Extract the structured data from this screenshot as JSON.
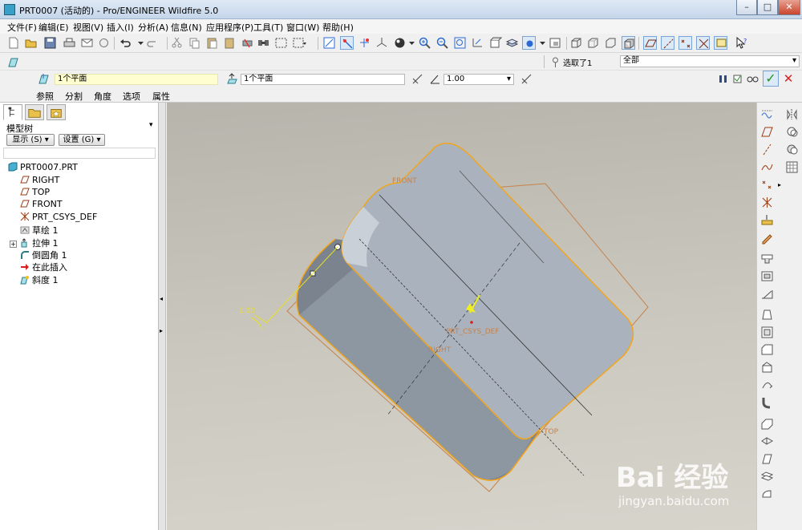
{
  "window": {
    "title": "PRT0007 (活动的) - Pro/ENGINEER Wildfire 5.0",
    "minimize": "–",
    "maximize": "□",
    "close": "✕"
  },
  "menu": [
    "文件(F)",
    "编辑(E)",
    "视图(V)",
    "插入(I)",
    "分析(A)",
    "信息(N)",
    "应用程序(P)",
    "工具(T)",
    "窗口(W)",
    "帮助(H)"
  ],
  "dashboard": {
    "selection_status": "选取了1",
    "filter_value": "全部",
    "ref1_value": "1个平面",
    "ref2_value": "1个平面",
    "angle_value": "1.00",
    "tabs": [
      "参照",
      "分割",
      "角度",
      "选项",
      "属性"
    ],
    "ok_label": "✓",
    "cancel_label": "✕"
  },
  "model_tree": {
    "title": "模型树",
    "show_button": "显示 (S) ▾",
    "settings_button": "设置 (G) ▾",
    "items": [
      {
        "label": "PRT0007.PRT",
        "icon": "part-icon"
      },
      {
        "label": "RIGHT",
        "icon": "datum-plane-icon"
      },
      {
        "label": "TOP",
        "icon": "datum-plane-icon"
      },
      {
        "label": "FRONT",
        "icon": "datum-plane-icon"
      },
      {
        "label": "PRT_CSYS_DEF",
        "icon": "csys-icon"
      },
      {
        "label": "草绘 1",
        "icon": "sketch-icon"
      },
      {
        "label": "拉伸 1",
        "icon": "extrude-icon"
      },
      {
        "label": "倒圆角 1",
        "icon": "round-icon"
      },
      {
        "label": "在此插入",
        "icon": "insert-arrow-icon"
      },
      {
        "label": "斜度 1",
        "icon": "draft-icon"
      }
    ]
  },
  "viewport_labels": {
    "front": "FRONT",
    "right": "RIGHT",
    "top": "TOP",
    "csys": "PRT_CSYS_DEF",
    "angle_dim": "1.00"
  },
  "watermark": {
    "brand": "Bai 经验",
    "url": "jingyan.baidu.com"
  },
  "colors": {
    "model_face": "#aab3bd",
    "highlight_edge": "#f2a51c",
    "background_top": "#b6b4ab"
  }
}
